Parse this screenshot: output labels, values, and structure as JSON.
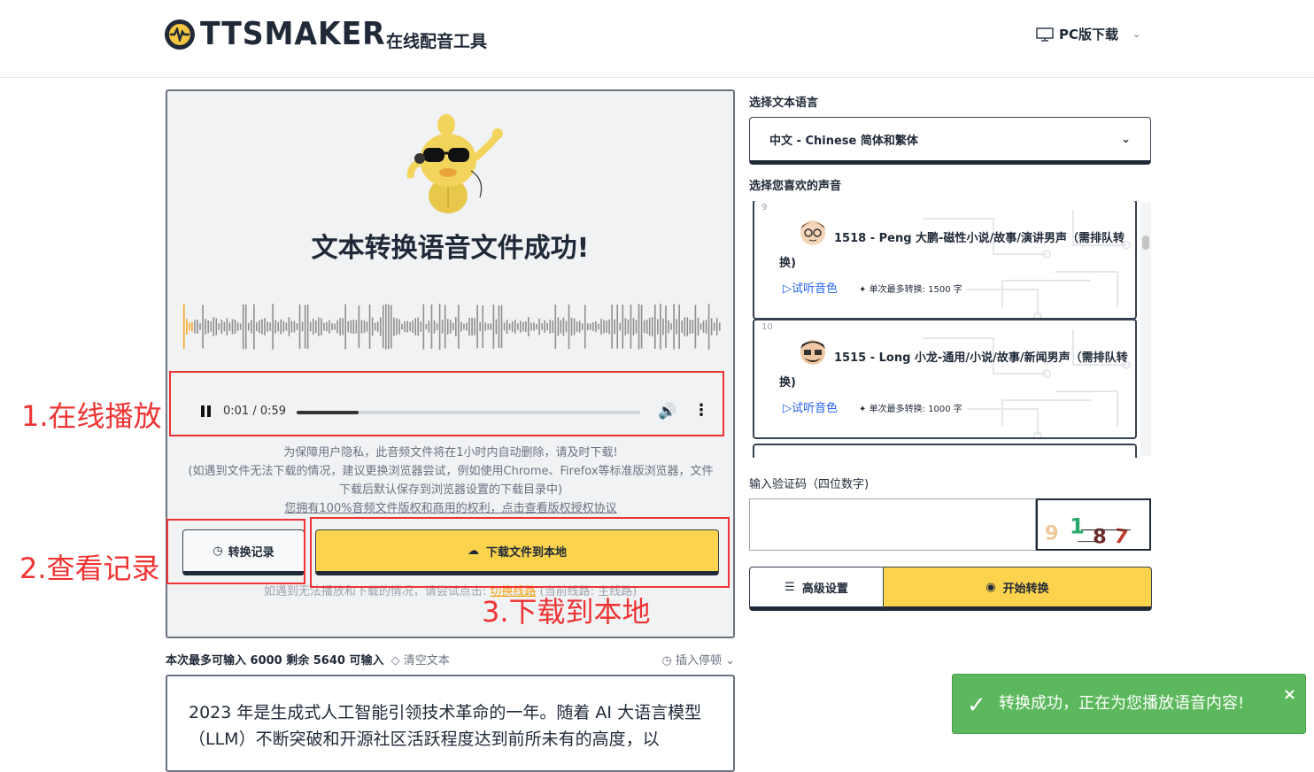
{
  "header": {
    "logo_text": "TTSMAKER",
    "logo_subtitle": "在线配音工具",
    "pc_download": "PC版下载"
  },
  "result": {
    "title": "文本转换语音文件成功!",
    "player": {
      "current_time": "0:01",
      "separator": " / ",
      "duration": "0:59",
      "progress_fraction": 0.02
    },
    "notice_line1": "为保障用户隐私，此音频文件将在1小时内自动删除，请及时下载!",
    "notice_line2": "(如遇到文件无法下载的情况，建议更换浏览器尝试，例如使用Chrome、Firefox等标准版浏览器，文件下载后默认保存到浏览器设置的下载目录中)",
    "notice_link": "您拥有100%音频文件版权和商用的权利，点击查看版权授权协议",
    "history_button": "转换记录",
    "download_button": "下载文件到本地",
    "alt_prefix": "如遇到无法播放和下载的情况，请尝试点击:",
    "alt_link": "切换线路",
    "alt_suffix": "(当前线路: 主线路)"
  },
  "annotations": {
    "play_label": "1.在线播放",
    "history_label": "2.查看记录",
    "download_label": "3.下载到本地",
    "color": "#ef3333"
  },
  "input": {
    "max_label": "本次最多可输入 6000 剩余 5640 可输入",
    "clear_label": "清空文本",
    "insert_pause": "插入停顿",
    "text": "2023 年是生成式人工智能引领技术革命的一年。随着 AI 大语言模型（LLM）不断突破和开源社区活跃程度达到前所未有的高度，以"
  },
  "settings": {
    "lang_label": "选择文本语言",
    "lang_value": "中文 - Chinese 简体和繁体",
    "voice_label": "选择您喜欢的声音",
    "voices": [
      {
        "index": "9",
        "name": "1518 - Peng 大鹏-磁性小说/故事/演讲男声（需排队转",
        "name_wrap": "换)",
        "listen": "试听音色",
        "max_chars": "单次最多转换: 1500 字"
      },
      {
        "index": "10",
        "name": "1515 - Long 小龙-通用/小说/故事/新闻男声（需排队转",
        "name_wrap": "换)",
        "listen": "试听音色",
        "max_chars": "单次最多转换: 1000 字"
      }
    ],
    "captcha_label": "输入验证码（四位数字)",
    "captcha_digits": [
      "9",
      "1",
      "8",
      "7"
    ],
    "advanced_button": "高级设置",
    "start_button": "开始转换"
  },
  "toast": {
    "message": "转换成功，正在为您播放语音内容!",
    "color": "#5cb85c"
  },
  "colors": {
    "accent_yellow": "#fcd34d",
    "dark": "#1f2937"
  }
}
